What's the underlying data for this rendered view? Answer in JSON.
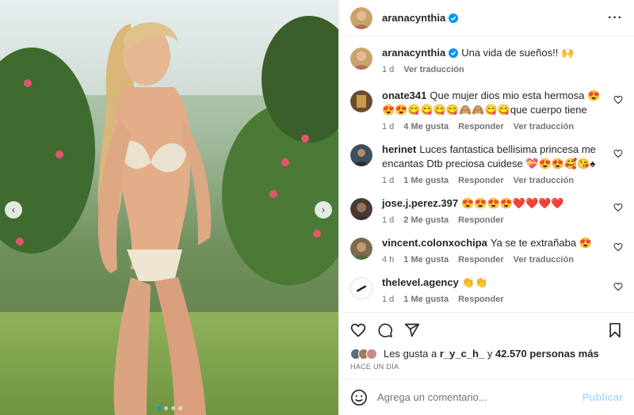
{
  "post": {
    "username": "aranacynthia",
    "more_icon": "more-horizontal-icon"
  },
  "caption": {
    "username": "aranacynthia",
    "text": "Una vida de sueños!! 🙌",
    "time": "1 d",
    "translate": "Ver traducción"
  },
  "comments": [
    {
      "user": "onate341",
      "text": "Que mujer dios mio esta hermosa 😍😍😍😋😋😋😋🙈🙈😋😋que cuerpo tiene",
      "time": "1 d",
      "likes": "4 Me gusta",
      "reply": "Responder",
      "translate": "Ver traducción",
      "avatar_color": "#6b4a2e"
    },
    {
      "user": "herinet",
      "text": "Luces fantastica bellisima princesa me encantas Dtb preciosa cuidese 💝😍😍🥰😘♠",
      "time": "1 d",
      "likes": "1 Me gusta",
      "reply": "Responder",
      "translate": "Ver traducción",
      "avatar_color": "#3b4f5c"
    },
    {
      "user": "jose.j.perez.397",
      "text": "😍😍😍😍❤️❤️❤️❤️",
      "time": "1 d",
      "likes": "2 Me gusta",
      "reply": "Responder",
      "translate": "",
      "avatar_color": "#4a3b32"
    },
    {
      "user": "vincent.colonxochipa",
      "text": "Ya se te extrañaba 😍",
      "time": "4 h",
      "likes": "1 Me gusta",
      "reply": "Responder",
      "translate": "Ver traducción",
      "avatar_color": "#7a6a4e"
    },
    {
      "user": "thelevel.agency",
      "text": "👏👏",
      "time": "1 d",
      "likes": "1 Me gusta",
      "reply": "Responder",
      "translate": "",
      "avatar_color": "#222222"
    }
  ],
  "likes": {
    "prefix": "Les gusta a",
    "user": "r_y_c_h_",
    "middle": "y",
    "count": "42.570 personas más"
  },
  "time_ago": "HACE UN DÍA",
  "composer": {
    "placeholder": "Agrega un comentario...",
    "post_label": "Publicar"
  },
  "colors": {
    "verified": "#0095f6",
    "muted": "#737373",
    "post_disabled": "#b3dbff"
  }
}
